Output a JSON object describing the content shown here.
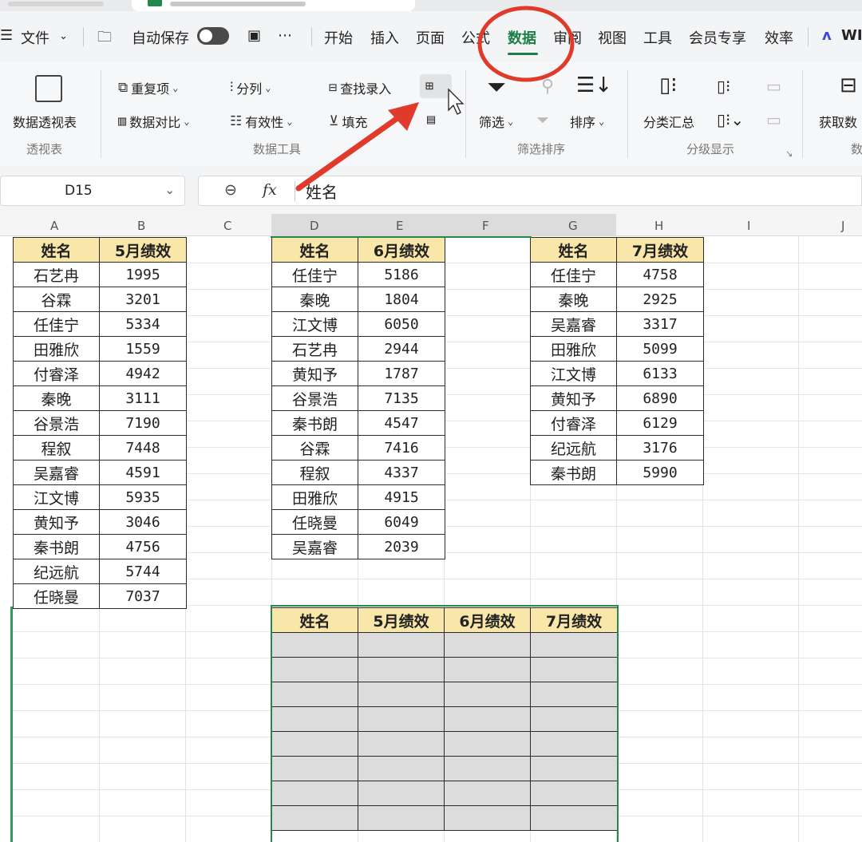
{
  "menu": {
    "file": "文件",
    "autosave": "自动保存",
    "more": "⋯",
    "tabs": [
      "开始",
      "插入",
      "页面",
      "公式",
      "数据",
      "审阅",
      "视图",
      "工具",
      "会员专享",
      "效率",
      "WI"
    ],
    "active_tab": "数据"
  },
  "ribbon": {
    "pivot": "数据透视表",
    "group_pivot": "透视表",
    "duplicates": "重复项",
    "compare": "数据对比",
    "split": "分列",
    "validity": "有效性",
    "lookup_entry": "查找录入",
    "fill": "填充",
    "group_tools": "数据工具",
    "filter": "筛选",
    "sort": "排序",
    "group_filter_sort": "筛选排序",
    "subtotal": "分类汇总",
    "group_outline": "分级显示",
    "get_data": "获取数",
    "group_get": "数"
  },
  "formula_bar": {
    "cell_ref": "D15",
    "fx": "fx",
    "value": "姓名"
  },
  "columns": [
    "A",
    "B",
    "C",
    "D",
    "E",
    "F",
    "G",
    "H",
    "I",
    "J"
  ],
  "table_may": {
    "headers": [
      "姓名",
      "5月绩效"
    ],
    "rows": [
      [
        "石艺冉",
        "1995"
      ],
      [
        "谷霖",
        "3201"
      ],
      [
        "任佳宁",
        "5334"
      ],
      [
        "田雅欣",
        "1559"
      ],
      [
        "付睿泽",
        "4942"
      ],
      [
        "秦晚",
        "3111"
      ],
      [
        "谷景浩",
        "7190"
      ],
      [
        "程叙",
        "7448"
      ],
      [
        "吴嘉睿",
        "4591"
      ],
      [
        "江文博",
        "5935"
      ],
      [
        "黄知予",
        "3046"
      ],
      [
        "秦书朗",
        "4756"
      ],
      [
        "纪远航",
        "5744"
      ],
      [
        "任晓曼",
        "7037"
      ]
    ]
  },
  "table_june": {
    "headers": [
      "姓名",
      "6月绩效"
    ],
    "rows": [
      [
        "任佳宁",
        "5186"
      ],
      [
        "秦晚",
        "1804"
      ],
      [
        "江文博",
        "6050"
      ],
      [
        "石艺冉",
        "2944"
      ],
      [
        "黄知予",
        "1787"
      ],
      [
        "谷景浩",
        "7135"
      ],
      [
        "秦书朗",
        "4547"
      ],
      [
        "谷霖",
        "7416"
      ],
      [
        "程叙",
        "4337"
      ],
      [
        "田雅欣",
        "4915"
      ],
      [
        "任晓曼",
        "6049"
      ],
      [
        "吴嘉睿",
        "2039"
      ]
    ]
  },
  "table_july": {
    "headers": [
      "姓名",
      "7月绩效"
    ],
    "rows": [
      [
        "任佳宁",
        "4758"
      ],
      [
        "秦晚",
        "2925"
      ],
      [
        "吴嘉睿",
        "3317"
      ],
      [
        "田雅欣",
        "5099"
      ],
      [
        "江文博",
        "6133"
      ],
      [
        "黄知予",
        "6890"
      ],
      [
        "付睿泽",
        "6129"
      ],
      [
        "纪远航",
        "3176"
      ],
      [
        "秦书朗",
        "5990"
      ]
    ]
  },
  "table_summary": {
    "headers": [
      "姓名",
      "5月绩效",
      "6月绩效",
      "7月绩效"
    ]
  },
  "colors": {
    "accent": "#1b7d45",
    "header_fill": "#f8e7a9",
    "annotation": "#e03a2a"
  }
}
